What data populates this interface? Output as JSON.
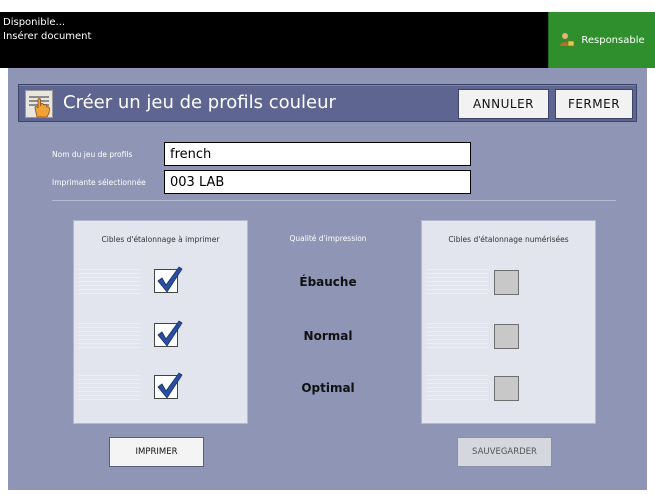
{
  "status": {
    "line1": "Disponible...",
    "line2": "Insérer document",
    "user_button": "Responsable",
    "bar_color": "#000000",
    "user_button_color": "#2f8f2c"
  },
  "dialog": {
    "title": "Créer un jeu de profils couleur",
    "title_icon": "hand-pointer-icon",
    "buttons": {
      "cancel": "ANNULER",
      "close": "FERMER"
    },
    "fields": {
      "profile_name": {
        "label": "Nom du jeu de profils",
        "value": "french"
      },
      "printer": {
        "label": "Imprimante sélectionnée",
        "value": "003  LAB"
      }
    },
    "print_targets": {
      "heading": "Cibles d'étalonnage à imprimer",
      "checked": [
        true,
        true,
        true
      ]
    },
    "quality": {
      "heading": "Qualité d'impression",
      "levels": [
        "Ébauche",
        "Normal",
        "Optimal"
      ]
    },
    "scanned_targets": {
      "heading": "Cibles d'étalonnage numérisées",
      "checked": [
        false,
        false,
        false
      ]
    },
    "actions": {
      "print": "IMPRIMER",
      "save": "SAUVEGARDER"
    },
    "panel_color": "#8e95b5",
    "title_bar_color": "#5d6590"
  }
}
